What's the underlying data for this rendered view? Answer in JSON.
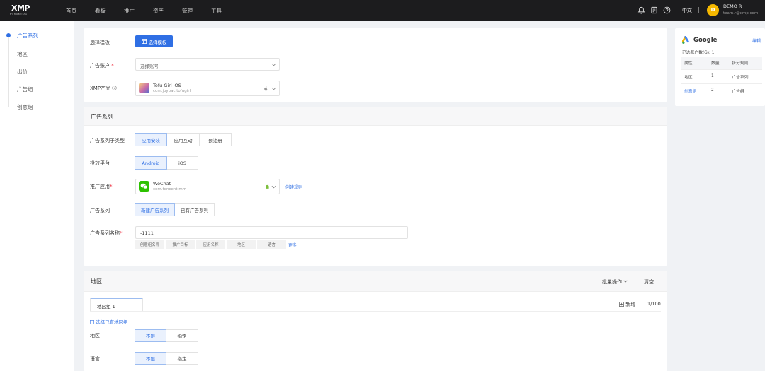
{
  "header": {
    "logo_main": "XMP",
    "logo_sub": "BY MOBVISTA",
    "nav": [
      "首页",
      "看板",
      "推广",
      "资产",
      "管理",
      "工具"
    ],
    "language": "中文",
    "avatar_letter": "D",
    "user_name": "DEMO R",
    "user_email": "team.r@xmp.com",
    "icons": [
      "bell-icon",
      "document-icon",
      "help-icon"
    ]
  },
  "sidebar": {
    "items": [
      "广告系列",
      "地区",
      "出价",
      "广告组",
      "创意组"
    ],
    "active_index": 0
  },
  "setup": {
    "template_label": "选择模板",
    "template_button": "选择模板",
    "account_label": "广告账户",
    "account_required": "*",
    "account_placeholder": "选择账号",
    "product_label": "XMP产品",
    "product_name": "Tofu Girl iOS",
    "product_pkg": "com.joypac.tofugirl"
  },
  "campaign": {
    "section_title": "广告系列",
    "subtype_label": "广告系列子类型",
    "subtype_options": [
      "应用安装",
      "应用互动",
      "预注册"
    ],
    "subtype_selected": 0,
    "platform_label": "投放平台",
    "platform_options": [
      "Android",
      "iOS"
    ],
    "platform_selected": 0,
    "app_label": "推广应用",
    "app_required": "*",
    "app_name": "WeChat",
    "app_pkg": "com.tencent.mm",
    "app_link": "创建规则",
    "series_label": "广告系列",
    "series_options": [
      "新建广告系列",
      "已有广告系列"
    ],
    "series_selected": 0,
    "name_label": "广告系列名称",
    "name_required": "*",
    "name_value": "-1111",
    "name_chips": [
      "创意组名称",
      "推广目标",
      "应用名称",
      "地区",
      "语言"
    ],
    "name_more": "更多"
  },
  "region": {
    "section_title": "地区",
    "batch_action": "批量操作",
    "clear": "清空",
    "tab_label": "地区组 1",
    "add_label": "新增",
    "count": "1/100",
    "choose_existing": "选择已有地区组",
    "area_label": "地区",
    "area_options": [
      "不限",
      "指定"
    ],
    "area_selected": 0,
    "lang_label": "语言",
    "lang_options": [
      "不限",
      "指定"
    ],
    "lang_selected": 0
  },
  "google_panel": {
    "title": "Google",
    "edit": "编辑",
    "summary_label": "已选账户数(G):",
    "summary_value": "1",
    "columns": [
      "属性",
      "数量",
      "拆分规则"
    ],
    "rows": [
      {
        "attr": "地区",
        "qty": "1",
        "rule": "广告系列"
      },
      {
        "attr": "创意组",
        "qty": "2",
        "rule": "广告组"
      }
    ]
  },
  "colors": {
    "accent": "#2f6fe4",
    "topbar": "#1c1c1e",
    "page_bg": "#f0f2f5"
  }
}
